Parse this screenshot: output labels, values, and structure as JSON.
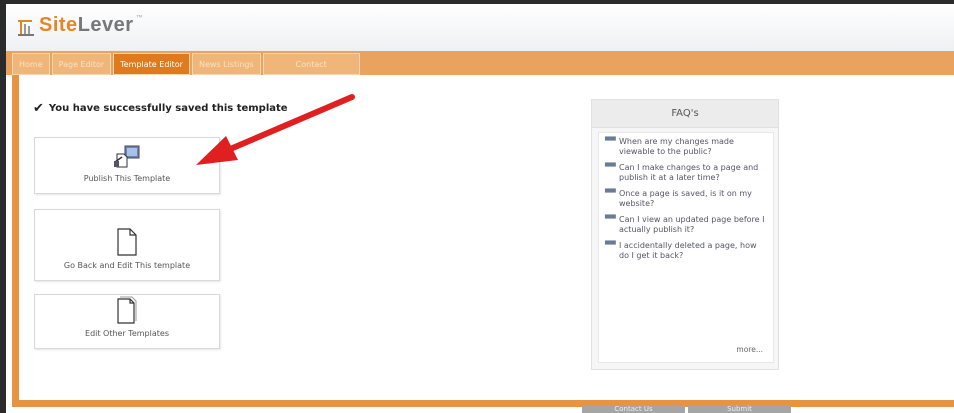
{
  "brand": {
    "site": "Site",
    "lever": "Lever",
    "tm": "™"
  },
  "nav": [
    "Home",
    "Page Editor",
    "Template Editor",
    "News Listings",
    "Contact"
  ],
  "success_message": "You have successfully saved this template",
  "cards": [
    {
      "label": "Publish This Template"
    },
    {
      "label": "Go Back and Edit This template"
    },
    {
      "label": "Edit Other Templates"
    }
  ],
  "faq": {
    "title": "FAQ's",
    "items": [
      "When are my changes made viewable to the public?",
      "Can I make changes to a page and publish it at a later time?",
      "Once a page is saved, is it on my website?",
      "Can I view an updated page before I actually publish it?",
      "I accidentally deleted a page, how do I get it back?"
    ],
    "more": "more..."
  },
  "bottom_buttons": [
    "Contact Us",
    "Submit"
  ],
  "colors": {
    "accent": "#e07a1f",
    "nav_bg": "#e9a35f",
    "border": "#e7933f",
    "arrow": "#e02020"
  }
}
